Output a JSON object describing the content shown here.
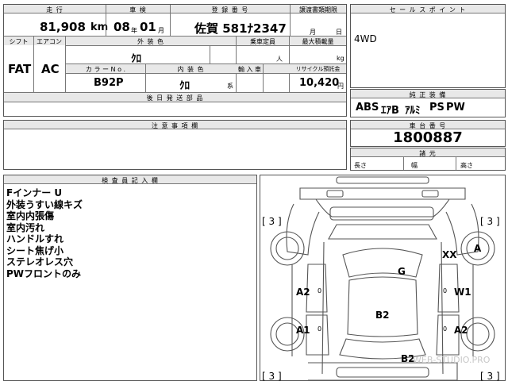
{
  "row1": {
    "mileage_label": "走 行",
    "mileage_value": "81,908",
    "mileage_unit": "km",
    "inspection_label": "車 検",
    "inspection_year": "08",
    "inspection_year_unit": "年",
    "inspection_month": "01",
    "inspection_month_unit": "月",
    "registration_label": "登 録 番 号",
    "registration_value": "佐賀 581ﾅ2347",
    "transfer_label": "譲渡書類期限",
    "transfer_month_unit": "月",
    "transfer_day_unit": "日"
  },
  "row2": {
    "shift_label": "シフト",
    "aircon_label": "エアコン",
    "ext_color_label": "外 装 色",
    "capacity_label": "乗車定員",
    "load_label": "最大積載量",
    "shift_value": "FAT",
    "aircon_value": "AC",
    "ext_color_value": "ｸﾛ",
    "capacity_unit": "人",
    "load_unit": "kg",
    "color_no_label": "カ ラ ー N o .",
    "int_color_label": "内 装 色",
    "import_label": "輸 入 車",
    "recycle_label": "リサイクル預託金",
    "color_no_value": "B92P",
    "int_color_value": "ｸﾛ",
    "int_color_unit": "系",
    "recycle_value": "10,420",
    "recycle_unit": "円"
  },
  "later_docs_label": "後 日 発 送 部 品",
  "caution_label": "注 意 事 項 欄",
  "sales_point": {
    "label": "セ ー ル ス ポ イ ン ト",
    "value": "4WD"
  },
  "equipment": {
    "label": "純 正 装 備",
    "items": [
      "ABS",
      "ｴｱB",
      "ｱﾙﾐ",
      "PS",
      "PW"
    ]
  },
  "chassis": {
    "label": "車 台 番 号",
    "value": "1800887"
  },
  "dimensions": {
    "label": "諸 元",
    "length_label": "長さ",
    "width_label": "幅",
    "height_label": "高さ"
  },
  "inspector": {
    "label": "検 査 員 記 入 欄",
    "notes": [
      "Fインナー U",
      "外装うすい線キズ",
      "室内内張傷",
      "室内汚れ",
      "ハンドルすれ",
      "シート焦げ小",
      "ステレオレス穴",
      "PWフロントのみ"
    ]
  },
  "diagram": {
    "marks": {
      "front_left_tire": "[ 3 ]",
      "front_right_tire": "[ 3 ]",
      "rear_left_tire": "[ 3 ]",
      "rear_right_tire": "[ 3 ]",
      "glass": "G",
      "front_right_fender": "XX",
      "front_right_wheel": "A",
      "left_front_door": "A2",
      "left_front_door_zero": "0",
      "right_front_door": "W1",
      "right_front_door_zero": "0",
      "roof": "B2",
      "left_rear_door": "A1",
      "left_rear_door_zero": "0",
      "right_rear_door": "A2",
      "right_rear_door_zero": "0",
      "rear": "B2"
    },
    "watermark": "WEB-STUDIO.PRO"
  }
}
